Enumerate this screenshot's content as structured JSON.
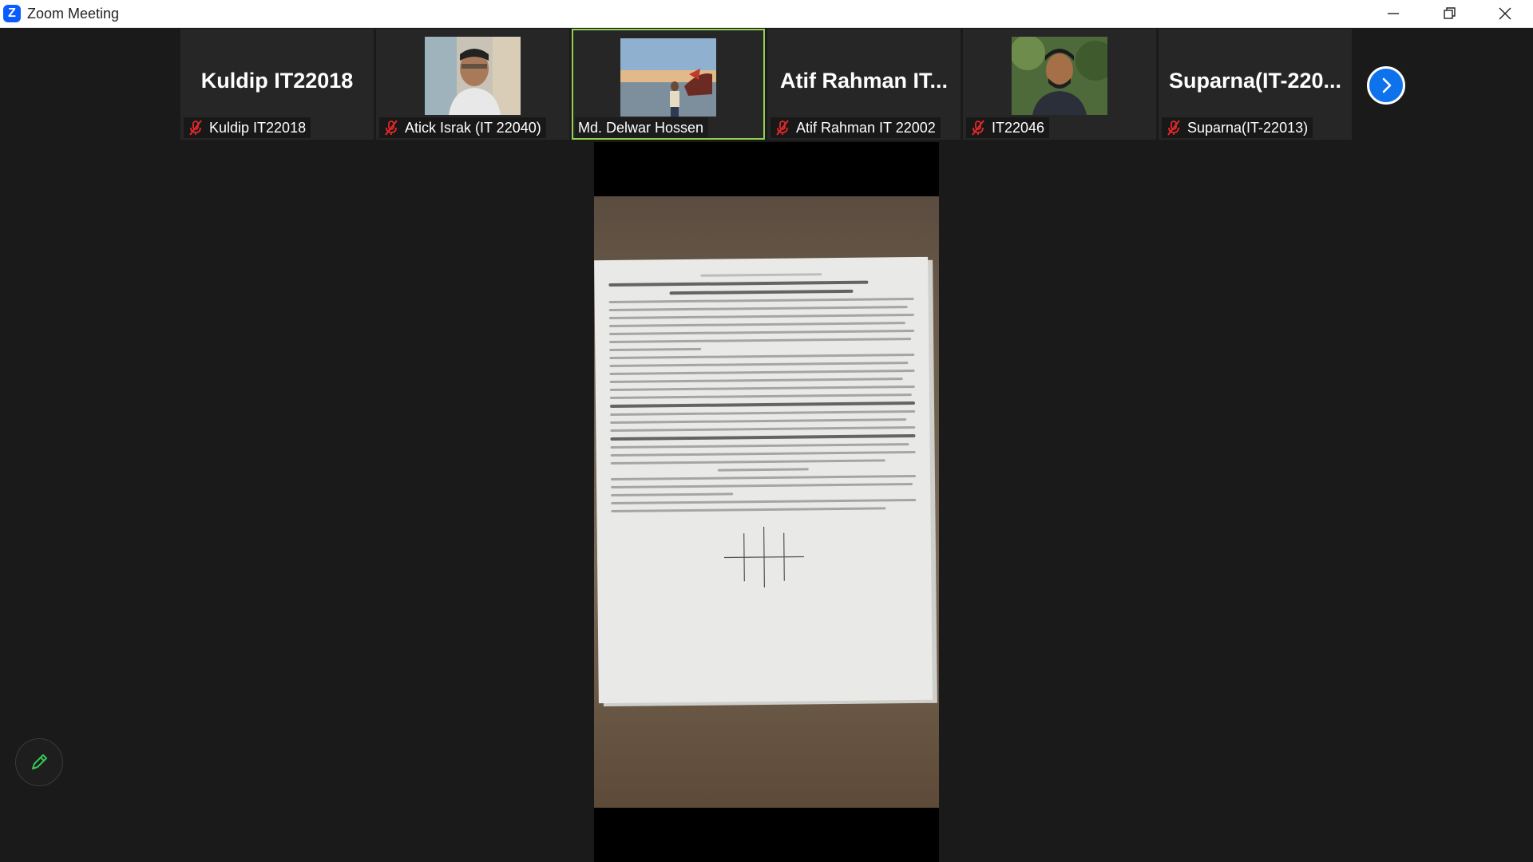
{
  "window": {
    "title": "Zoom Meeting",
    "controls": [
      "minimize-icon",
      "restore-icon",
      "close-icon"
    ]
  },
  "colors": {
    "accent": "#0e72ed",
    "active_speaker_border": "#8fd14f",
    "muted_icon": "#e02828",
    "background": "#1a1a1a"
  },
  "gallery": {
    "participants": [
      {
        "big_name": "Kuldip IT22018",
        "label": "Kuldip IT22018",
        "muted": true,
        "video": false
      },
      {
        "big_name": "",
        "label": "Atick Israk (IT 22040)",
        "muted": true,
        "video": true
      },
      {
        "big_name": "",
        "label": "Md. Delwar Hossen",
        "muted": false,
        "video": true,
        "active": true
      },
      {
        "big_name": "Atif  Rahman  IT...",
        "label": "Atif Rahman IT 22002",
        "muted": true,
        "video": false
      },
      {
        "big_name": "",
        "label": "IT22046",
        "muted": true,
        "video": true
      },
      {
        "big_name": "Suparna(IT-220...",
        "label": "Suparna(IT-22013)",
        "muted": true,
        "video": false
      }
    ],
    "next_icon": "chevron-right-icon"
  },
  "toolbar": {
    "annotate_icon": "pencil-icon"
  }
}
